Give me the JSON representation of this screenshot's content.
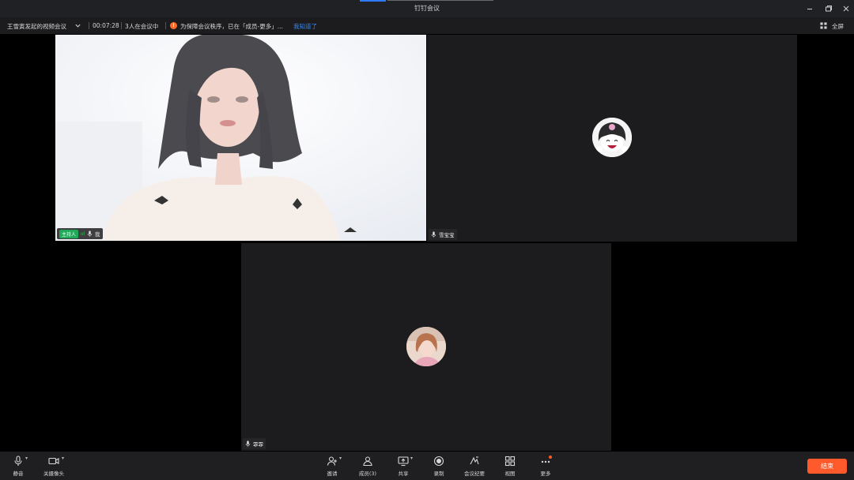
{
  "window": {
    "title": "钉钉会议",
    "controls": [
      "minimize-icon",
      "restore-icon",
      "close-icon"
    ]
  },
  "info_bar": {
    "meeting_name": "王雪寅发起的视频会议",
    "duration": "00:07:28",
    "participants": "3人在会议中",
    "notice": "为保障会议秩序，已在「成员-更多」...",
    "notice_action": "我知道了",
    "fullscreen_label": "全屏"
  },
  "tiles": [
    {
      "name": "我",
      "host_badge": "主持人",
      "signal": "ııl",
      "muted": false,
      "video": true
    },
    {
      "name": "雪宝宝",
      "muted": false,
      "video": false,
      "avatar": "cartoon-avatar"
    },
    {
      "name": "霏霏",
      "muted": false,
      "video": false,
      "avatar": "photo-avatar"
    }
  ],
  "toolbar": {
    "left": [
      {
        "label": "静音",
        "icon": "microphone-icon"
      },
      {
        "label": "关摄像头",
        "icon": "camera-icon"
      }
    ],
    "center": [
      {
        "label": "邀请",
        "icon": "invite-icon"
      },
      {
        "label": "成员(3)",
        "icon": "members-icon"
      },
      {
        "label": "共享",
        "icon": "share-screen-icon"
      },
      {
        "label": "录制",
        "icon": "record-icon"
      },
      {
        "label": "会议纪要",
        "icon": "minutes-icon"
      },
      {
        "label": "视图",
        "icon": "view-grid-icon"
      },
      {
        "label": "更多",
        "icon": "more-icon"
      }
    ],
    "end_label": "结束"
  },
  "colors": {
    "accent": "#2f7bff",
    "end": "#ff5a2c",
    "host": "#1faa59",
    "warning": "#ff6a2b"
  }
}
